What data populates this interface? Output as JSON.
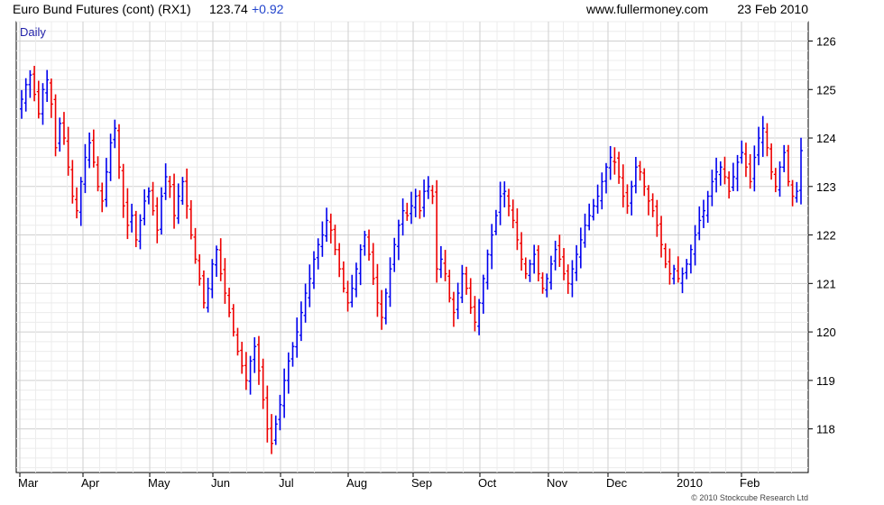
{
  "header": {
    "instrument": "Euro Bund Futures (cont) (RX1)",
    "price": "123.74",
    "change": "+0.92",
    "source": "www.fullermoney.com",
    "date": "23 Feb 2010"
  },
  "period_label": "Daily",
  "copyright": "© 2010 Stockcube Research Ltd",
  "colors": {
    "up": "#0000ee",
    "down": "#ee0000",
    "grid": "#dddddd",
    "frame": "#000000",
    "period": "#2222aa",
    "change": "#2244cc"
  },
  "chart_data": {
    "type": "ohlc",
    "ylim": [
      117.1,
      126.4
    ],
    "y_ticks": [
      118,
      119,
      120,
      121,
      122,
      123,
      124,
      125,
      126
    ],
    "x_labels": [
      "Mar",
      "Apr",
      "May",
      "Jun",
      "Jul",
      "Aug",
      "Sep",
      "Oct",
      "Nov",
      "Dec",
      "2010",
      "Feb"
    ],
    "grid": true,
    "approximate_closes": [
      124.8,
      125.1,
      125.3,
      124.9,
      124.5,
      125.0,
      125.2,
      124.7,
      123.8,
      124.3,
      124.0,
      123.4,
      122.8,
      122.5,
      123.1,
      123.6,
      123.9,
      123.5,
      123.0,
      122.7,
      123.3,
      123.9,
      124.2,
      123.4,
      122.6,
      122.2,
      122.4,
      121.9,
      122.3,
      122.7,
      122.9,
      122.5,
      122.1,
      122.8,
      123.2,
      123.0,
      122.4,
      122.8,
      123.1,
      122.6,
      122.0,
      121.5,
      121.1,
      120.6,
      120.9,
      121.4,
      121.7,
      121.2,
      120.8,
      120.4,
      120.0,
      119.6,
      119.3,
      119.0,
      119.4,
      119.7,
      119.2,
      118.6,
      118.0,
      117.7,
      118.1,
      118.5,
      119.0,
      119.4,
      119.7,
      120.0,
      120.4,
      120.8,
      121.1,
      121.5,
      121.8,
      122.0,
      122.3,
      122.1,
      121.7,
      121.3,
      120.9,
      120.6,
      120.9,
      121.3,
      121.7,
      122.0,
      121.6,
      121.1,
      120.6,
      120.3,
      120.8,
      121.3,
      121.8,
      122.2,
      122.5,
      122.4,
      122.6,
      122.8,
      122.5,
      122.9,
      123.0,
      122.8,
      121.3,
      121.5,
      121.2,
      120.7,
      120.4,
      120.8,
      121.2,
      120.9,
      120.5,
      120.2,
      120.6,
      121.1,
      121.6,
      122.0,
      122.4,
      122.8,
      122.9,
      122.6,
      122.3,
      121.9,
      121.5,
      121.2,
      121.4,
      121.6,
      121.2,
      120.9,
      121.1,
      121.4,
      121.7,
      121.5,
      121.2,
      121.0,
      121.3,
      121.6,
      121.9,
      122.2,
      122.4,
      122.6,
      122.8,
      123.1,
      123.4,
      123.6,
      123.5,
      123.2,
      122.8,
      122.6,
      123.0,
      123.4,
      123.3,
      123.0,
      122.7,
      122.5,
      122.2,
      121.8,
      121.4,
      121.2,
      121.3,
      121.1,
      121.2,
      121.4,
      121.7,
      122.0,
      122.3,
      122.5,
      122.8,
      123.1,
      123.3,
      123.4,
      123.2,
      122.9,
      123.2,
      123.5,
      123.7,
      123.4,
      123.1,
      123.6,
      124.0,
      124.2,
      123.8,
      123.3,
      123.0,
      123.4,
      123.7,
      123.1,
      122.8,
      122.9,
      123.74
    ]
  }
}
